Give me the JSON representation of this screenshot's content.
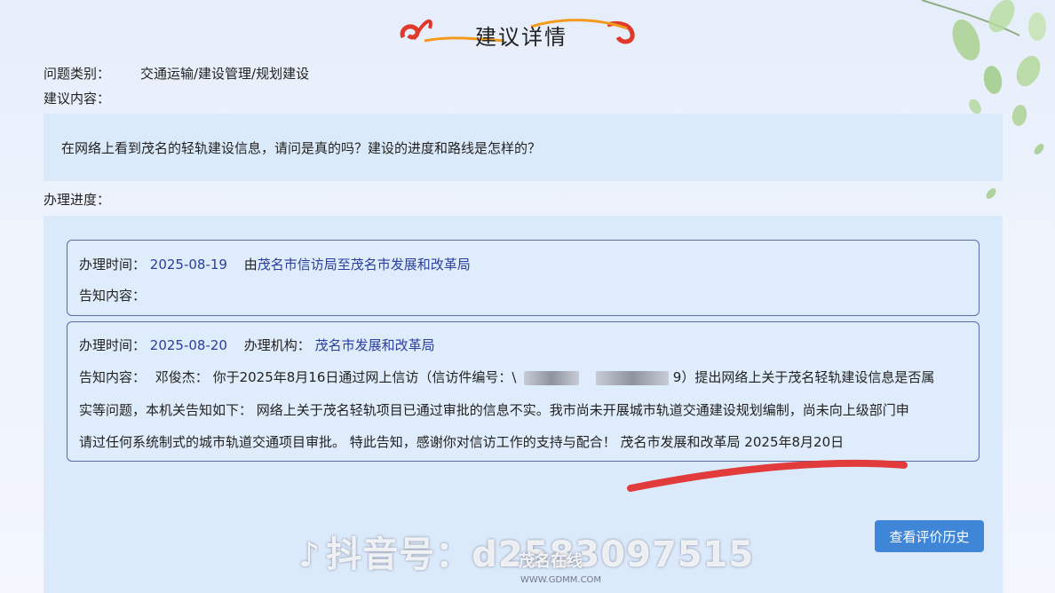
{
  "header": {
    "title": "建议详情"
  },
  "category": {
    "label": "问题类别：",
    "value": "交通运输/建设管理/规划建设"
  },
  "suggestion": {
    "label": "建议内容：",
    "text": "在网络上看到茂名的轻轨建设信息，请问是真的吗？建设的进度和路线是怎样的？"
  },
  "progress": {
    "label": "办理进度：",
    "records": [
      {
        "time_label": "办理时间：",
        "time": "2025-08-19",
        "route_prefix": "由",
        "route": "茂名市信访局至茂名市发展和改革局",
        "notice_label": "告知内容："
      },
      {
        "time_label": "办理时间：",
        "time": "2025-08-20",
        "org_label": "办理机构：",
        "org": "茂名市发展和改革局",
        "notice_label": "告知内容：",
        "line1_a": "邓俊杰：  你于2025年8月16日通过网上信访（信访件编号：\\",
        "line1_b": "9）提出网络上关于茂名轻轨建设信息是否属",
        "line2": "实等问题，本机关告知如下：  网络上关于茂名轻轨项目已通过审批的信息不实。我市尚未开展城市轨道交通建设规划编制，尚未向上级部门申",
        "line3": "请过任何系统制式的城市轨道交通项目审批。  特此告知，感谢你对信访工作的支持与配合！  茂名市发展和改革局 2025年8月20日"
      }
    ]
  },
  "buttons": {
    "eval_history": "查看评价历史"
  },
  "watermark": {
    "douyin": "抖音号：d2583097515",
    "site": "茂名在线",
    "site_url": "WWW.GDMM.COM"
  },
  "icons": {
    "title_decor": "swoosh-icon",
    "leaves": "leaf-icon",
    "douyin": "tiktok-icon"
  },
  "colors": {
    "accent_blue": "#2a3ea0",
    "button_bg": "#3f86d8",
    "panel_bg": "#dbeafb",
    "title_decor_red": "#e0392a",
    "title_decor_orange": "#f39a1e"
  }
}
